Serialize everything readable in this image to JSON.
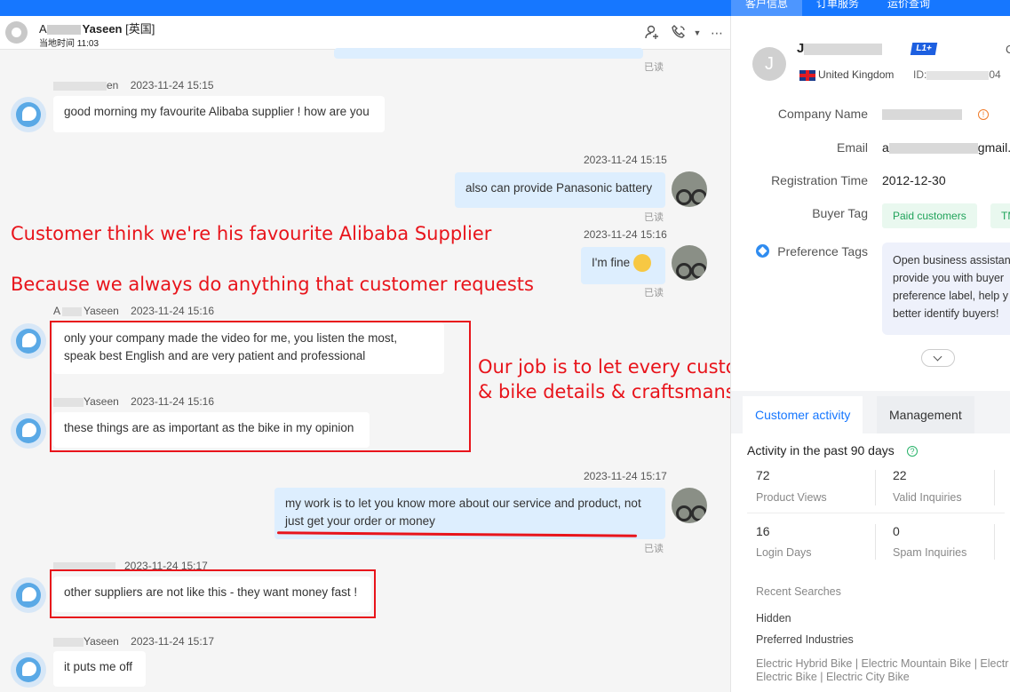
{
  "top_tabs": [
    "客户信息",
    "订单服务",
    "运价查询"
  ],
  "chat_header": {
    "name": "Yaseen",
    "country": "[英国]",
    "local_time": "当地时间 11:03"
  },
  "read_label": "已读",
  "messages": {
    "m1": {
      "time": "2023-11-24 15:15",
      "name_suffix": "en",
      "text": "good morning my favourite Alibaba supplier ! how are you"
    },
    "m2": {
      "time": "2023-11-24 15:15",
      "text": "also can provide Panasonic battery"
    },
    "m3": {
      "time": "2023-11-24 15:16",
      "text": "I'm fine"
    },
    "m4": {
      "time": "2023-11-24 15:16",
      "name": "Yaseen",
      "line1": "only your company made the video for me, you listen the most,",
      "line2": "speak best English and are very patient and professional"
    },
    "m5": {
      "time": "2023-11-24 15:16",
      "name": "Yaseen",
      "text": "these things are as important as the bike in my opinion"
    },
    "m6": {
      "time": "2023-11-24 15:17",
      "line1": "my work is to let you know more about our service and product, not",
      "line2": "just get your order or money"
    },
    "m7": {
      "time": "2023-11-24 15:17",
      "text": "other suppliers are not like this - they want money fast !"
    },
    "m8": {
      "time": "2023-11-24 15:17",
      "name": "Yaseen",
      "text": "it puts me off"
    }
  },
  "annotations": {
    "note1": "Customer think we're his favourite Alibaba Supplier",
    "note2": "Because we always do anything that customer requests",
    "note3_line1": "Our job is to let every customer know our quality",
    "note3_line2": "& bike details & craftsmanship"
  },
  "buyer": {
    "avatar_letter": "J",
    "level": "L1+",
    "country": "United Kingdom",
    "id_label": "ID:",
    "id_suffix": "04",
    "edge_char": "C",
    "company_label": "Company Name",
    "email_label": "Email",
    "email_suffix": "gmail.c",
    "reg_label": "Registration Time",
    "reg_value": "2012-12-30",
    "buyer_tag_label": "Buyer Tag",
    "tag1": "Paid customers",
    "tag2": "TM",
    "pref_label": "Preference Tags",
    "pref_line1": "Open business assistant",
    "pref_line2": "provide you with buyer",
    "pref_line3": "preference label, help y",
    "pref_line4": "better identify buyers!"
  },
  "side_tabs": {
    "activity": "Customer activity",
    "management": "Management"
  },
  "activity": {
    "title": "Activity in the past 90 days",
    "product_views": {
      "value": "72",
      "label": "Product Views"
    },
    "valid_inquiries": {
      "value": "22",
      "label": "Valid Inquiries"
    },
    "login_days": {
      "value": "16",
      "label": "Login Days"
    },
    "spam_inquiries": {
      "value": "0",
      "label": "Spam Inquiries"
    },
    "recent_searches_label": "Recent Searches",
    "hidden": "Hidden",
    "preferred_industries_label": "Preferred Industries",
    "industries_line1": "Electric Hybrid Bike | Electric Mountain Bike | Electr",
    "industries_line2": "Electric Bike | Electric City Bike"
  }
}
